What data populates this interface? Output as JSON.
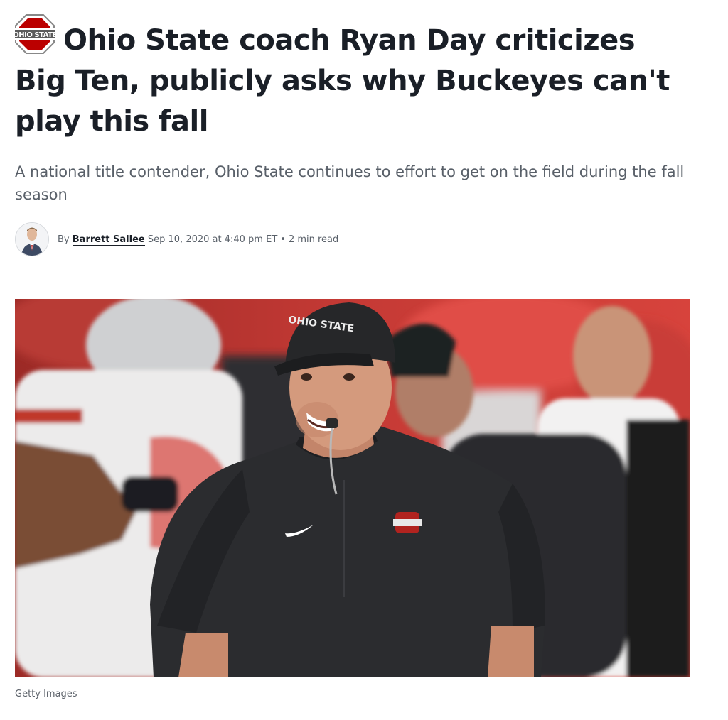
{
  "article": {
    "team_logo_icon": "ohio-state-logo-icon",
    "headline": "Ohio State coach Ryan Day criticizes Big Ten, publicly asks why Buckeyes can't play this fall",
    "dek": "A national title contender, Ohio State continues to effort to get on the field during the fall season",
    "byline": {
      "prefix": "By",
      "author": "Barrett Sallee",
      "date": "Sep 10, 2020 at 4:40 pm ET",
      "separator": "•",
      "read_time": "2 min read"
    },
    "photo": {
      "credit": "Getty Images"
    }
  },
  "colors": {
    "headline": "#1a1f27",
    "dek": "#596069",
    "scarlet": "#bb0000",
    "gray": "#666666"
  }
}
